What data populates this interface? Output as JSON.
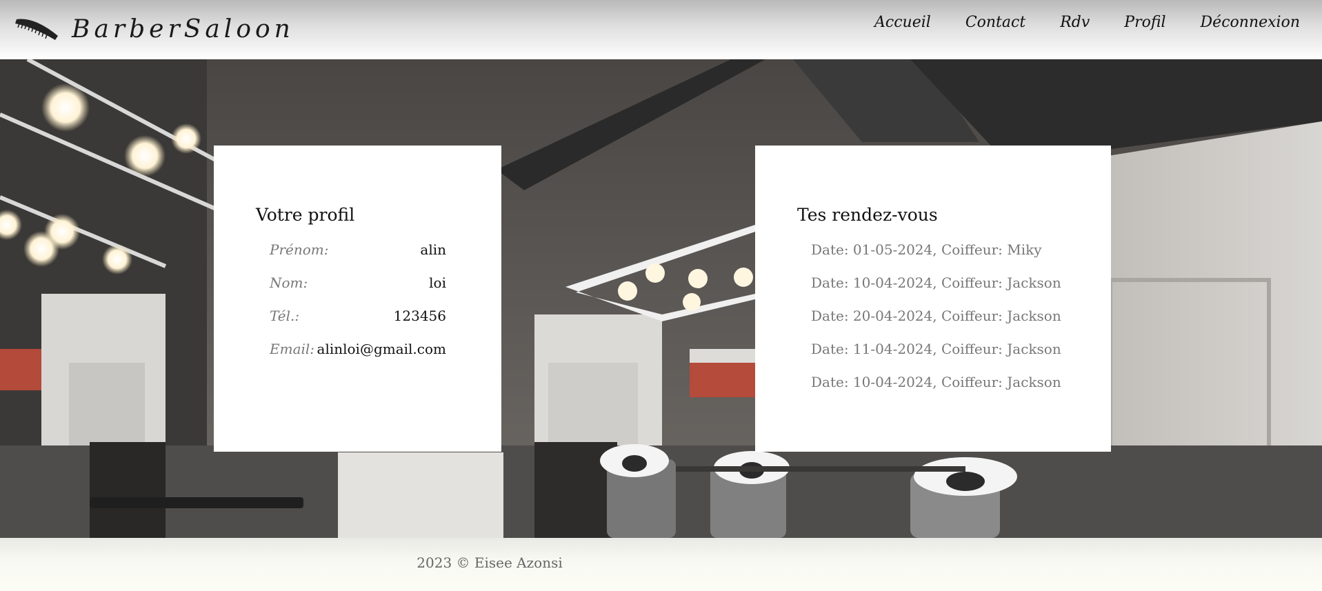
{
  "header": {
    "brand": "BarberSaloon",
    "nav": [
      "Accueil",
      "Contact",
      "Rdv",
      "Profil",
      "Déconnexion"
    ]
  },
  "profile": {
    "title": "Votre profil",
    "fields": [
      {
        "label": "Prénom:",
        "value": "alin"
      },
      {
        "label": "Nom:",
        "value": "loi"
      },
      {
        "label": "Tél.:",
        "value": "123456"
      },
      {
        "label": "Email:",
        "value": "alinloi@gmail.com"
      }
    ]
  },
  "appointments": {
    "title": "Tes rendez-vous",
    "items": [
      "Date: 01-05-2024, Coiffeur: Miky",
      "Date: 10-04-2024, Coiffeur: Jackson",
      "Date: 20-04-2024, Coiffeur: Jackson",
      "Date: 11-04-2024, Coiffeur: Jackson",
      "Date: 10-04-2024, Coiffeur: Jackson"
    ]
  },
  "footer": {
    "text": "2023 © Eisee Azonsi"
  }
}
